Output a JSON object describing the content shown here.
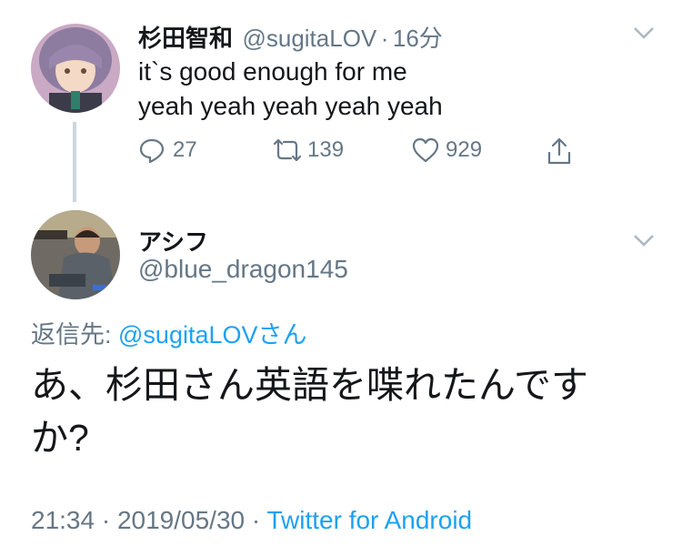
{
  "tweet1": {
    "display_name": "杉田智和",
    "handle": "@sugitaLOV",
    "separator": "·",
    "time": "16分",
    "line1": "it`s good enough for me",
    "line2": "yeah yeah yeah yeah yeah",
    "reply_count": "27",
    "retweet_count": "139",
    "like_count": "929"
  },
  "tweet2": {
    "display_name": "アシフ",
    "handle": "@blue_dragon145",
    "reply_to_prefix": "返信先: ",
    "reply_to_handle": "@sugitaLOV",
    "reply_to_suffix": "さん",
    "text_line1": "あ、杉田さん英語を喋れたんです",
    "text_line2": "か?",
    "timestamp": "21:34 · 2019/05/30 · ",
    "source": "Twitter for Android"
  },
  "icons": [
    "reply-icon",
    "retweet-icon",
    "like-icon",
    "share-icon",
    "chevron-down-icon"
  ],
  "colors": {
    "link": "#1da1f2",
    "secondary": "#657786",
    "thread_line": "#ccd6dd"
  }
}
